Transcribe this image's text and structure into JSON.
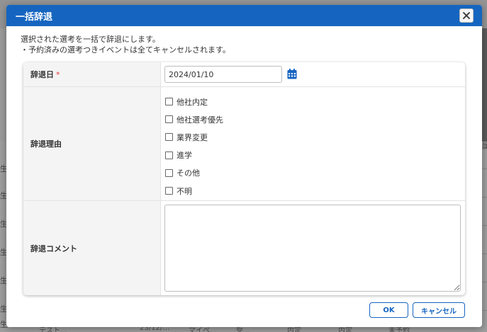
{
  "background": {
    "row_labels": [
      "生",
      "生",
      "生",
      "生",
      "生",
      "生",
      "生"
    ],
    "right_edge_text": "属",
    "bottom_row": [
      "テスト…",
      "23/12/…",
      "マイペ…",
      "受…",
      "内定",
      "内定",
      "未予約"
    ]
  },
  "dialog": {
    "title": "一括辞退",
    "close_icon": "close-icon",
    "description": [
      "選択された選考を一括で辞退にします。",
      "・予約済みの選考つきイベントは全てキャンセルされます。"
    ],
    "form": {
      "date": {
        "label": "辞退日",
        "required_mark": "*",
        "value": "2024/01/10",
        "icon": "calendar-icon"
      },
      "reason": {
        "label": "辞退理由",
        "options": [
          {
            "label": "他社内定",
            "checked": false
          },
          {
            "label": "他社選考優先",
            "checked": false
          },
          {
            "label": "業界変更",
            "checked": false
          },
          {
            "label": "進学",
            "checked": false
          },
          {
            "label": "その他",
            "checked": false
          },
          {
            "label": "不明",
            "checked": false
          }
        ]
      },
      "comment": {
        "label": "辞退コメント",
        "value": ""
      }
    },
    "buttons": {
      "ok": "OK",
      "cancel": "キャンセル"
    }
  },
  "colors": {
    "header_blue": "#1565c0",
    "calendar_blue": "#1565c0",
    "required_red": "#e53935"
  }
}
